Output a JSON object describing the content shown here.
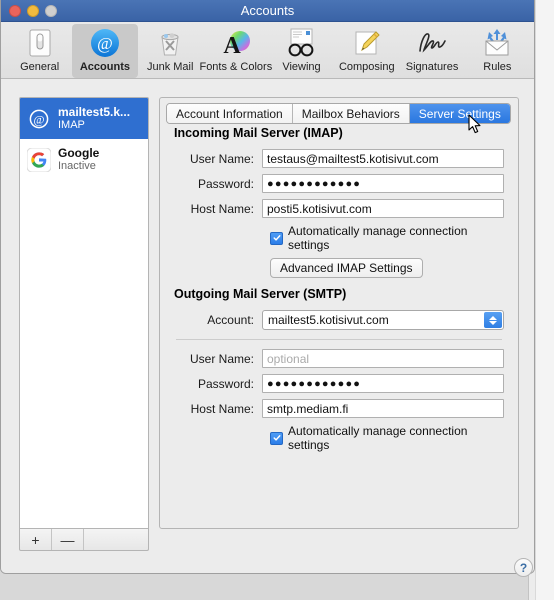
{
  "window": {
    "title": "Accounts",
    "traffic_lights": [
      "close",
      "minimize",
      "zoom-disabled"
    ]
  },
  "toolbar": {
    "items": [
      {
        "label": "General",
        "icon": "general-icon",
        "selected": false
      },
      {
        "label": "Accounts",
        "icon": "accounts-at-icon",
        "selected": true
      },
      {
        "label": "Junk Mail",
        "icon": "junk-mail-icon",
        "selected": false
      },
      {
        "label": "Fonts & Colors",
        "icon": "fonts-colors-icon",
        "selected": false
      },
      {
        "label": "Viewing",
        "icon": "viewing-glasses-icon",
        "selected": false
      },
      {
        "label": "Composing",
        "icon": "composing-pencil-icon",
        "selected": false
      },
      {
        "label": "Signatures",
        "icon": "signature-icon",
        "selected": false
      },
      {
        "label": "Rules",
        "icon": "rules-envelope-icon",
        "selected": false
      }
    ]
  },
  "sidebar": {
    "accounts": [
      {
        "name": "mailtest5.k...",
        "status": "IMAP",
        "icon": "at-sign-icon",
        "selected": true
      },
      {
        "name": "Google",
        "status": "Inactive",
        "icon": "google-g-icon",
        "selected": false
      }
    ],
    "add_label": "+",
    "remove_label": "—"
  },
  "tabs": [
    {
      "label": "Account Information",
      "active": false
    },
    {
      "label": "Mailbox Behaviors",
      "active": false
    },
    {
      "label": "Server Settings",
      "active": true
    }
  ],
  "incoming": {
    "heading": "Incoming Mail Server (IMAP)",
    "user_name_label": "User Name:",
    "user_name_value": "testaus@mailtest5.kotisivut.com",
    "password_label": "Password:",
    "password_value": "●●●●●●●●●●●●",
    "host_name_label": "Host Name:",
    "host_name_value": "posti5.kotisivut.com",
    "auto_manage_label": "Automatically manage connection settings",
    "auto_manage_checked": true,
    "advanced_button": "Advanced IMAP Settings"
  },
  "outgoing": {
    "heading": "Outgoing Mail Server (SMTP)",
    "account_label": "Account:",
    "account_value": "mailtest5.kotisivut.com",
    "user_name_label": "User Name:",
    "user_name_value": "",
    "user_name_placeholder": "optional",
    "password_label": "Password:",
    "password_value": "●●●●●●●●●●●●",
    "host_name_label": "Host Name:",
    "host_name_value": "smtp.mediam.fi",
    "auto_manage_label": "Automatically manage connection settings",
    "auto_manage_checked": true
  },
  "help": {
    "label": "?"
  },
  "colors": {
    "titlebar": "#3a63a6",
    "selection_blue": "#2f6fd0",
    "tab_active_blue": "#2a77e0",
    "window_bg": "#ececec"
  }
}
